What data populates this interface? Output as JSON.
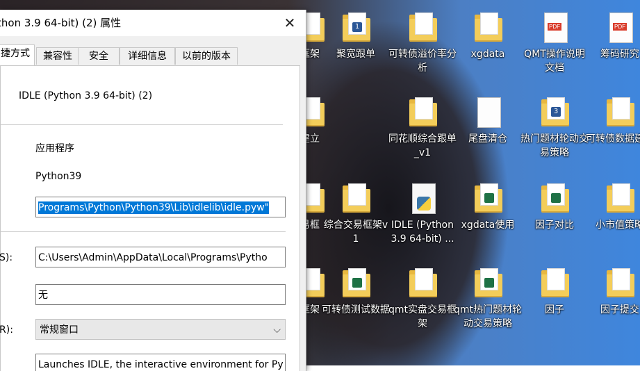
{
  "desktop": {
    "icons": [
      {
        "label": "框架",
        "type": "folder",
        "badge": ""
      },
      {
        "label": "聚宽跟单",
        "type": "folder",
        "badge": "1"
      },
      {
        "label": "可转债溢价率分析",
        "type": "folder",
        "badge": ""
      },
      {
        "label": "xgdata",
        "type": "folder",
        "badge": ""
      },
      {
        "label": "QMT操作说明文档",
        "type": "pdf",
        "badge": ""
      },
      {
        "label": "筹码研究",
        "type": "pdf",
        "badge": ""
      },
      {
        "label": "建立",
        "type": "folder",
        "badge": ""
      },
      {
        "label": "同花顺综合跟单_v1",
        "type": "folder",
        "badge": ""
      },
      {
        "label": "尾盘清仓",
        "type": "doc",
        "badge": ""
      },
      {
        "label": "热门题材轮动交易策略",
        "type": "folder",
        "badge": "3"
      },
      {
        "label": "可转债数据建立",
        "type": "folder",
        "badge": ""
      },
      {
        "label": "易框",
        "type": "folder",
        "badge": ""
      },
      {
        "label": "综合交易框架v1",
        "type": "folder",
        "badge": ""
      },
      {
        "label": "IDLE (Python 3.9 64-bit) ...",
        "type": "python",
        "badge": ""
      },
      {
        "label": "xgdata使用",
        "type": "folder",
        "badge": "S"
      },
      {
        "label": "因子对比",
        "type": "folder",
        "badge": "S"
      },
      {
        "label": "小市值策略",
        "type": "folder",
        "badge": ""
      },
      {
        "label": "框架",
        "type": "folder",
        "badge": ""
      },
      {
        "label": "可转债测试数据",
        "type": "folder",
        "badge": "S"
      },
      {
        "label": "qmt实盘交易框架",
        "type": "folder",
        "badge": ""
      },
      {
        "label": "qmt热门题材轮动交易策略",
        "type": "folder",
        "badge": "S"
      },
      {
        "label": "因子",
        "type": "folder",
        "badge": ""
      },
      {
        "label": "因子提交",
        "type": "folder",
        "badge": ""
      }
    ]
  },
  "dialog": {
    "title": "thon 3.9 64-bit) (2) 属性",
    "close_glyph": "✕",
    "tabs": [
      "捷方式",
      "兼容性",
      "安全",
      "详细信息",
      "以前的版本"
    ],
    "shortcut_name": "IDLE (Python 3.9 64-bit) (2)",
    "target_type": "应用程序",
    "target_location": "Python39",
    "target": "Programs\\Python\\Python39\\Lib\\idlelib\\idle.pyw\"",
    "start_in_label": "S):",
    "start_in": "C:\\Users\\Admin\\AppData\\Local\\Programs\\Pytho",
    "shortcut_key": "无",
    "run_label": "R):",
    "run_value": "常规窗口",
    "comment": "Launches IDLE, the interactive environment for Py"
  },
  "colors": {
    "folder": "#f3cd5a",
    "selection": "#0078d7",
    "excel_badge": "#1e7145",
    "word_badge": "#2b5797"
  }
}
